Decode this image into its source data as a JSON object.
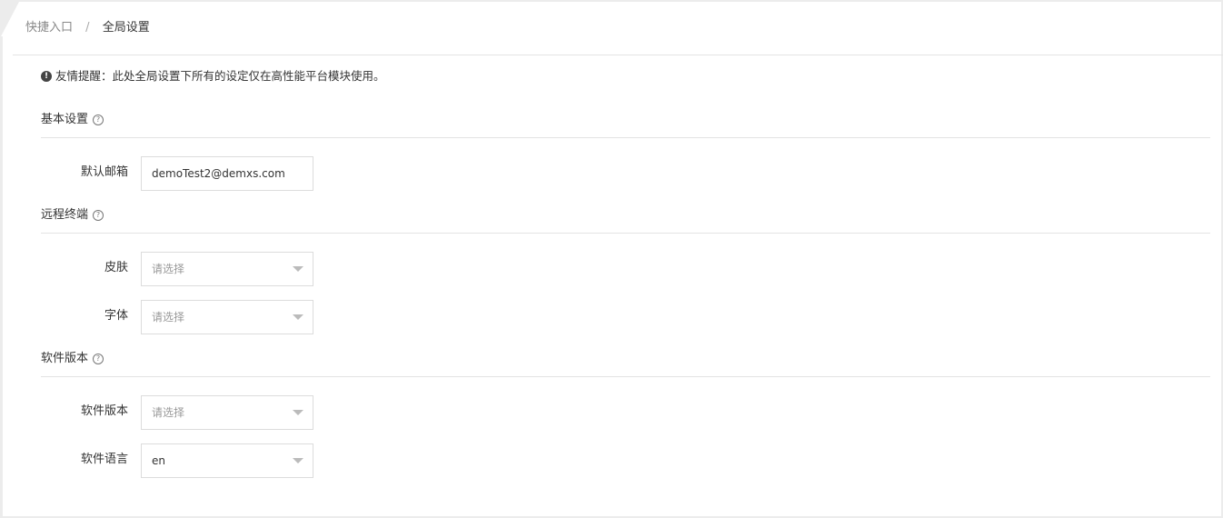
{
  "breadcrumb": {
    "link": "快捷入口",
    "separator": "/",
    "current": "全局设置"
  },
  "notice": {
    "icon": "exclamation-circle-icon",
    "text": "友情提醒：此处全局设置下所有的设定仅在高性能平台模块使用。"
  },
  "sections": {
    "basic": {
      "title": "基本设置",
      "default_email": {
        "label": "默认邮箱",
        "value": "demoTest2@demxs.com"
      }
    },
    "remote": {
      "title": "远程终端",
      "skin": {
        "label": "皮肤",
        "placeholder": "请选择"
      },
      "font": {
        "label": "字体",
        "placeholder": "请选择"
      }
    },
    "software": {
      "title": "软件版本",
      "version": {
        "label": "软件版本",
        "placeholder": "请选择"
      },
      "language": {
        "label": "软件语言",
        "value": "en"
      }
    }
  },
  "icons": {
    "help": "question-circle-icon",
    "dropdown": "caret-down-icon"
  }
}
